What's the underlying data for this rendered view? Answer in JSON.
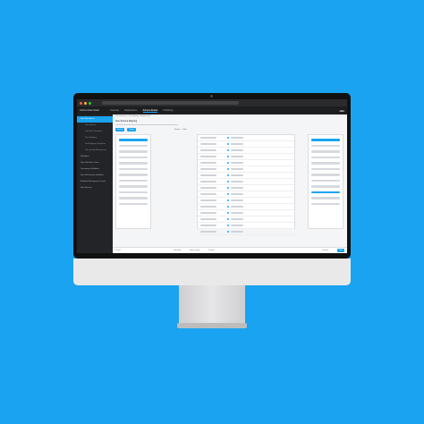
{
  "url": "",
  "brand": "Veritone Data Studio",
  "tabs": [
    {
      "label": "Overview"
    },
    {
      "label": "Data Explorer"
    },
    {
      "label": "Schema Builder"
    },
    {
      "label": "Publishing"
    }
  ],
  "logo": "ollo",
  "sidebar": [
    {
      "label": "Data Warehouse",
      "active": true,
      "sub": false
    },
    {
      "label": "Data Sources",
      "sub": true
    },
    {
      "label": "Data Path Templates",
      "sub": true
    },
    {
      "label": "Data Mapping",
      "sub": true
    },
    {
      "label": "Field Mapping Templates",
      "sub": true
    },
    {
      "label": "Data Quality Management",
      "sub": true
    },
    {
      "label": "Workflows",
      "sub": false
    },
    {
      "label": "Data Definition Center",
      "sub": false
    },
    {
      "label": "Consistency Validation",
      "sub": false
    },
    {
      "label": "Data Relationship Validation",
      "sub": false
    },
    {
      "label": "Metadata Management Center",
      "sub": false
    },
    {
      "label": "Data Services",
      "sub": false
    }
  ],
  "main": {
    "breadcrumb": "Data Warehouse / Data Mapping / Mapping Detail",
    "title": "New Schema Mapping",
    "toolbar": {
      "source_btn": "Source",
      "target_btn": "Target",
      "search": "Search",
      "filter": "Filter"
    },
    "footer": {
      "cancel": "Cancel",
      "auto_map": "Auto Map",
      "map_to_target": "Map to Target",
      "preview": "Preview",
      "back": "Previous",
      "next": "Next"
    }
  }
}
